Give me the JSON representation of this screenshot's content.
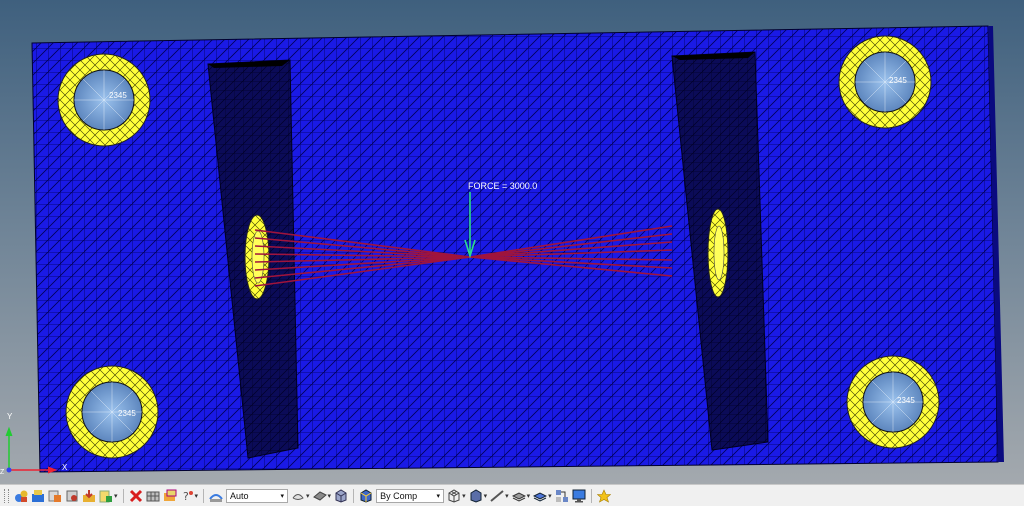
{
  "viewport": {
    "load_label": "FORCE = 3000.0",
    "node_labels": [
      "2345",
      "2345",
      "2345",
      "2345"
    ],
    "triad": {
      "y_label": "Y",
      "x_label": "X",
      "z_label": "Z"
    },
    "colors": {
      "mesh_fill": "#1a1ae6",
      "mesh_line": "#000050",
      "washer": "#ffff3a",
      "bolt_disc": "#7aa6dc",
      "rigid_spider": "#a0143c",
      "force_arrow": "#2ddc8c",
      "rib_dark": "#0c0c5a"
    }
  },
  "toolbar": {
    "vis_mode": {
      "value": "Auto"
    },
    "color_mode": {
      "value": "By Comp"
    },
    "icons": [
      "model-icon",
      "component-icon",
      "assembly-icon",
      "load-collector-icon",
      "import-icon",
      "export-icon",
      "delete-icon",
      "mesh-icon",
      "organize-icon",
      "question-icon",
      "wire-icon",
      "edge-icon",
      "solid-icon",
      "box-icon",
      "shaded-icon",
      "line-icon",
      "surface-icon",
      "element-icon",
      "network-icon",
      "monitor-icon",
      "star-icon"
    ]
  }
}
